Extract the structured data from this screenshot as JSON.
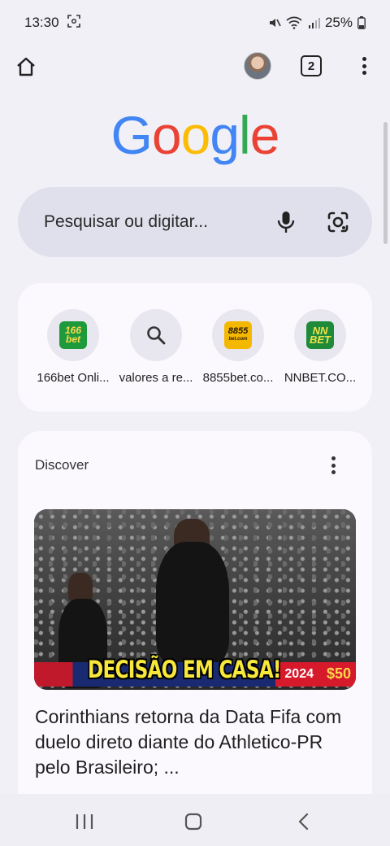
{
  "status_bar": {
    "time": "13:30",
    "battery": "25%"
  },
  "toolbar": {
    "tab_count": "2"
  },
  "logo": {
    "letters": [
      "G",
      "o",
      "o",
      "g",
      "l",
      "e"
    ],
    "colors": [
      "#4285F4",
      "#EA4335",
      "#FBBC05",
      "#4285F4",
      "#34A853",
      "#EA4335"
    ]
  },
  "search": {
    "placeholder": "Pesquisar ou digitar..."
  },
  "shortcuts": [
    {
      "label": "166bet Onli...",
      "icon": "166bet-favicon",
      "logo_text": "166 bet"
    },
    {
      "label": "valores a re...",
      "icon": "search-icon"
    },
    {
      "label": "8855bet.co...",
      "icon": "8855bet-favicon",
      "logo_text": "8855 bet.com"
    },
    {
      "label": "NNBET.CO...",
      "icon": "nnbet-favicon",
      "logo_text": "NN BET"
    }
  ],
  "discover": {
    "title": "Discover",
    "article": {
      "image_caption": "DECISÃO EM CASA!",
      "image_ad_text_1": "2024",
      "image_ad_text_2": "$50",
      "headline": "Corinthians retorna da Data Fifa com duelo direto diante do Athletico-PR pelo Brasileiro; ..."
    }
  }
}
